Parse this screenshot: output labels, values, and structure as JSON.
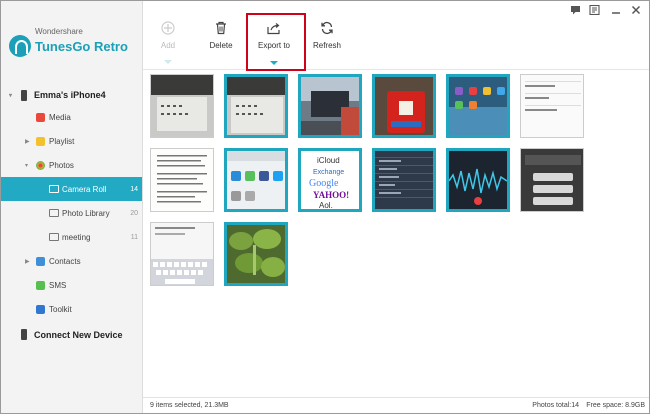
{
  "brand": {
    "company": "Wondershare",
    "product": "TunesGo Retro"
  },
  "window_controls": [
    "message-icon",
    "feedback-icon",
    "minimize-icon",
    "close-icon"
  ],
  "toolbar": {
    "add": "Add",
    "delete": "Delete",
    "export": "Export to",
    "refresh": "Refresh"
  },
  "sidebar": {
    "device": "Emma's iPhone4",
    "items": [
      {
        "label": "Media",
        "icon": "media-icon",
        "color": "#e8493b"
      },
      {
        "label": "Playlist",
        "icon": "playlist-icon",
        "color": "#f2c22e"
      },
      {
        "label": "Photos",
        "icon": "photos-icon",
        "color": "#f39c32"
      },
      {
        "label": "Camera Roll",
        "count": "14",
        "icon": "camera-roll-icon"
      },
      {
        "label": "Photo Library",
        "count": "20",
        "icon": "photo-library-icon"
      },
      {
        "label": "meeting",
        "count": "11",
        "icon": "album-icon"
      },
      {
        "label": "Contacts",
        "icon": "contacts-icon",
        "color": "#3f8fd6"
      },
      {
        "label": "SMS",
        "icon": "sms-icon",
        "color": "#56c04f"
      },
      {
        "label": "Toolkit",
        "icon": "toolkit-icon",
        "color": "#2f77d1"
      }
    ],
    "connect": "Connect New Device"
  },
  "thumbs": {
    "icloud": "iCloud",
    "exchange": "Exchange",
    "google": "Google",
    "yahoo": "YAHOO!",
    "aol": "Aol."
  },
  "status": {
    "selected": "9 items selected, 21.3MB",
    "total": "Photos total:14",
    "free": "Free space: 8.9GB"
  },
  "colors": {
    "accent": "#22a9c3",
    "highlight": "#d0021b"
  }
}
